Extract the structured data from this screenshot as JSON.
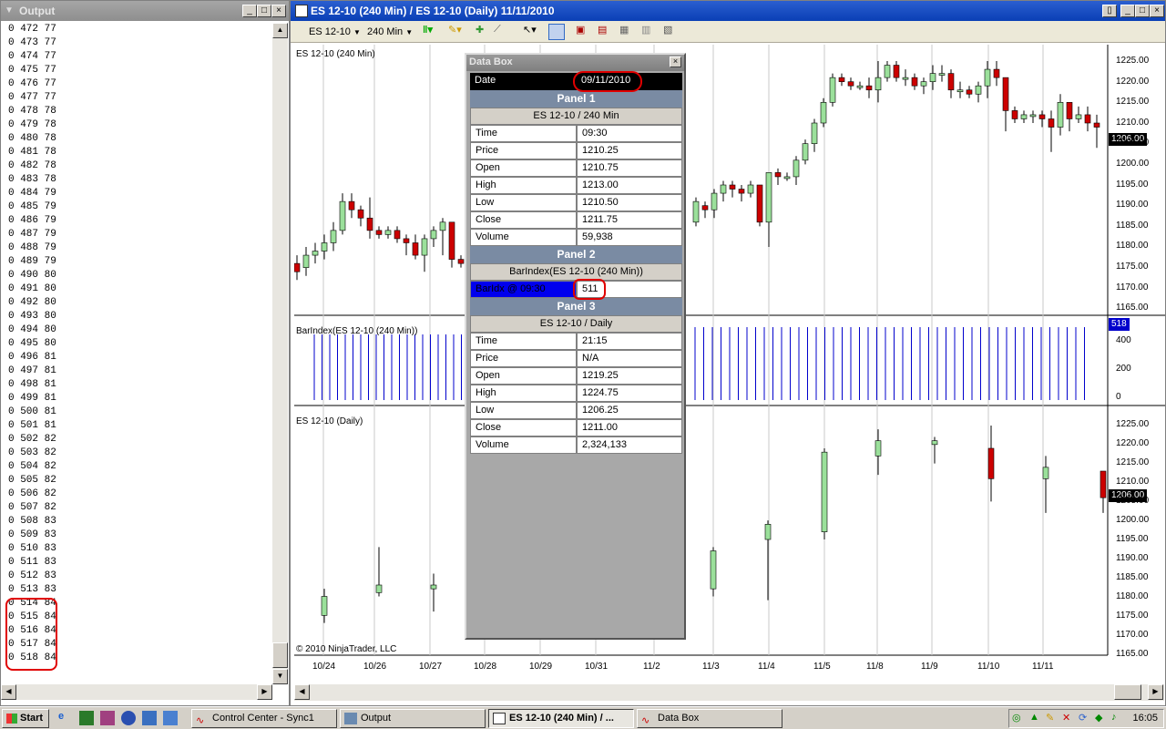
{
  "output_window": {
    "title": "Output",
    "rows": [
      "0 472 77",
      "0 473 77",
      "0 474 77",
      "0 475 77",
      "0 476 77",
      "0 477 77",
      "0 478 78",
      "0 479 78",
      "0 480 78",
      "0 481 78",
      "0 482 78",
      "0 483 78",
      "0 484 79",
      "0 485 79",
      "0 486 79",
      "0 487 79",
      "0 488 79",
      "0 489 79",
      "0 490 80",
      "0 491 80",
      "0 492 80",
      "0 493 80",
      "0 494 80",
      "0 495 80",
      "0 496 81",
      "0 497 81",
      "0 498 81",
      "0 499 81",
      "0 500 81",
      "0 501 81",
      "0 502 82",
      "0 503 82",
      "0 504 82",
      "0 505 82",
      "0 506 82",
      "0 507 82",
      "0 508 83",
      "0 509 83",
      "0 510 83",
      "0 511 83",
      "0 512 83",
      "0 513 83",
      "0 514 84",
      "0 515 84",
      "0 516 84",
      "0 517 84",
      "0 518 84"
    ]
  },
  "chart_window": {
    "title": "ES 12-10 (240 Min) / ES 12-10 (Daily)  11/11/2010",
    "toolbar": {
      "instrument": "ES 12-10",
      "interval": "240 Min"
    },
    "panel1_label": "ES 12-10 (240 Min)",
    "panel2_label": "BarIndex(ES 12-10 (240 Min))",
    "panel3_label": "ES 12-10 (Daily)",
    "panel1_price_tag": "1206.00",
    "panel2_value_tag": "518",
    "panel3_price_tag": "1206.00",
    "copyright": "© 2010 NinjaTrader, LLC",
    "panel1_yaxis": [
      "1225.00",
      "1220.00",
      "1215.00",
      "1210.00",
      "1205.00",
      "1200.00",
      "1195.00",
      "1190.00",
      "1185.00",
      "1180.00",
      "1175.00",
      "1170.00",
      "1165.00"
    ],
    "panel2_yaxis": [
      "400",
      "200",
      "0"
    ],
    "panel3_yaxis": [
      "1225.00",
      "1220.00",
      "1215.00",
      "1210.00",
      "1205.00",
      "1200.00",
      "1195.00",
      "1190.00",
      "1185.00",
      "1180.00",
      "1175.00",
      "1170.00",
      "1165.00"
    ],
    "xaxis": [
      "10/24",
      "10/26",
      "10/27",
      "10/28",
      "10/29",
      "10/31",
      "11/2",
      "11/3",
      "11/4",
      "11/5",
      "11/8",
      "11/9",
      "11/10",
      "11/11"
    ]
  },
  "databox": {
    "title": "Data Box",
    "date_label": "Date",
    "date_value": "09/11/2010",
    "panel1_header": "Panel 1",
    "panel1_sub": "ES 12-10 / 240 Min",
    "panel1_rows": [
      {
        "k": "Time",
        "v": "09:30"
      },
      {
        "k": "Price",
        "v": "1210.25"
      },
      {
        "k": "Open",
        "v": "1210.75"
      },
      {
        "k": "High",
        "v": "1213.00"
      },
      {
        "k": "Low",
        "v": "1210.50"
      },
      {
        "k": "Close",
        "v": "1211.75"
      },
      {
        "k": "Volume",
        "v": "59,938"
      }
    ],
    "panel2_header": "Panel 2",
    "panel2_sub": "BarIndex(ES 12-10 (240 Min))",
    "panel2_row": {
      "k": "BarIdx @ 09:30",
      "v": "511"
    },
    "panel3_header": "Panel 3",
    "panel3_sub": "ES 12-10 / Daily",
    "panel3_rows": [
      {
        "k": "Time",
        "v": "21:15"
      },
      {
        "k": "Price",
        "v": "N/A"
      },
      {
        "k": "Open",
        "v": "1219.25"
      },
      {
        "k": "High",
        "v": "1224.75"
      },
      {
        "k": "Low",
        "v": "1206.25"
      },
      {
        "k": "Close",
        "v": "1211.00"
      },
      {
        "k": "Volume",
        "v": "2,324,133"
      }
    ]
  },
  "taskbar": {
    "start": "Start",
    "tasks": [
      "Control Center - Sync1",
      "Output",
      "ES 12-10 (240 Min) / ...",
      "Data Box"
    ],
    "clock": "16:05"
  },
  "colors": {
    "bull": "#9be09b",
    "bear": "#cc0000",
    "barindex": "#0000cc",
    "highlight": "#e00000"
  }
}
